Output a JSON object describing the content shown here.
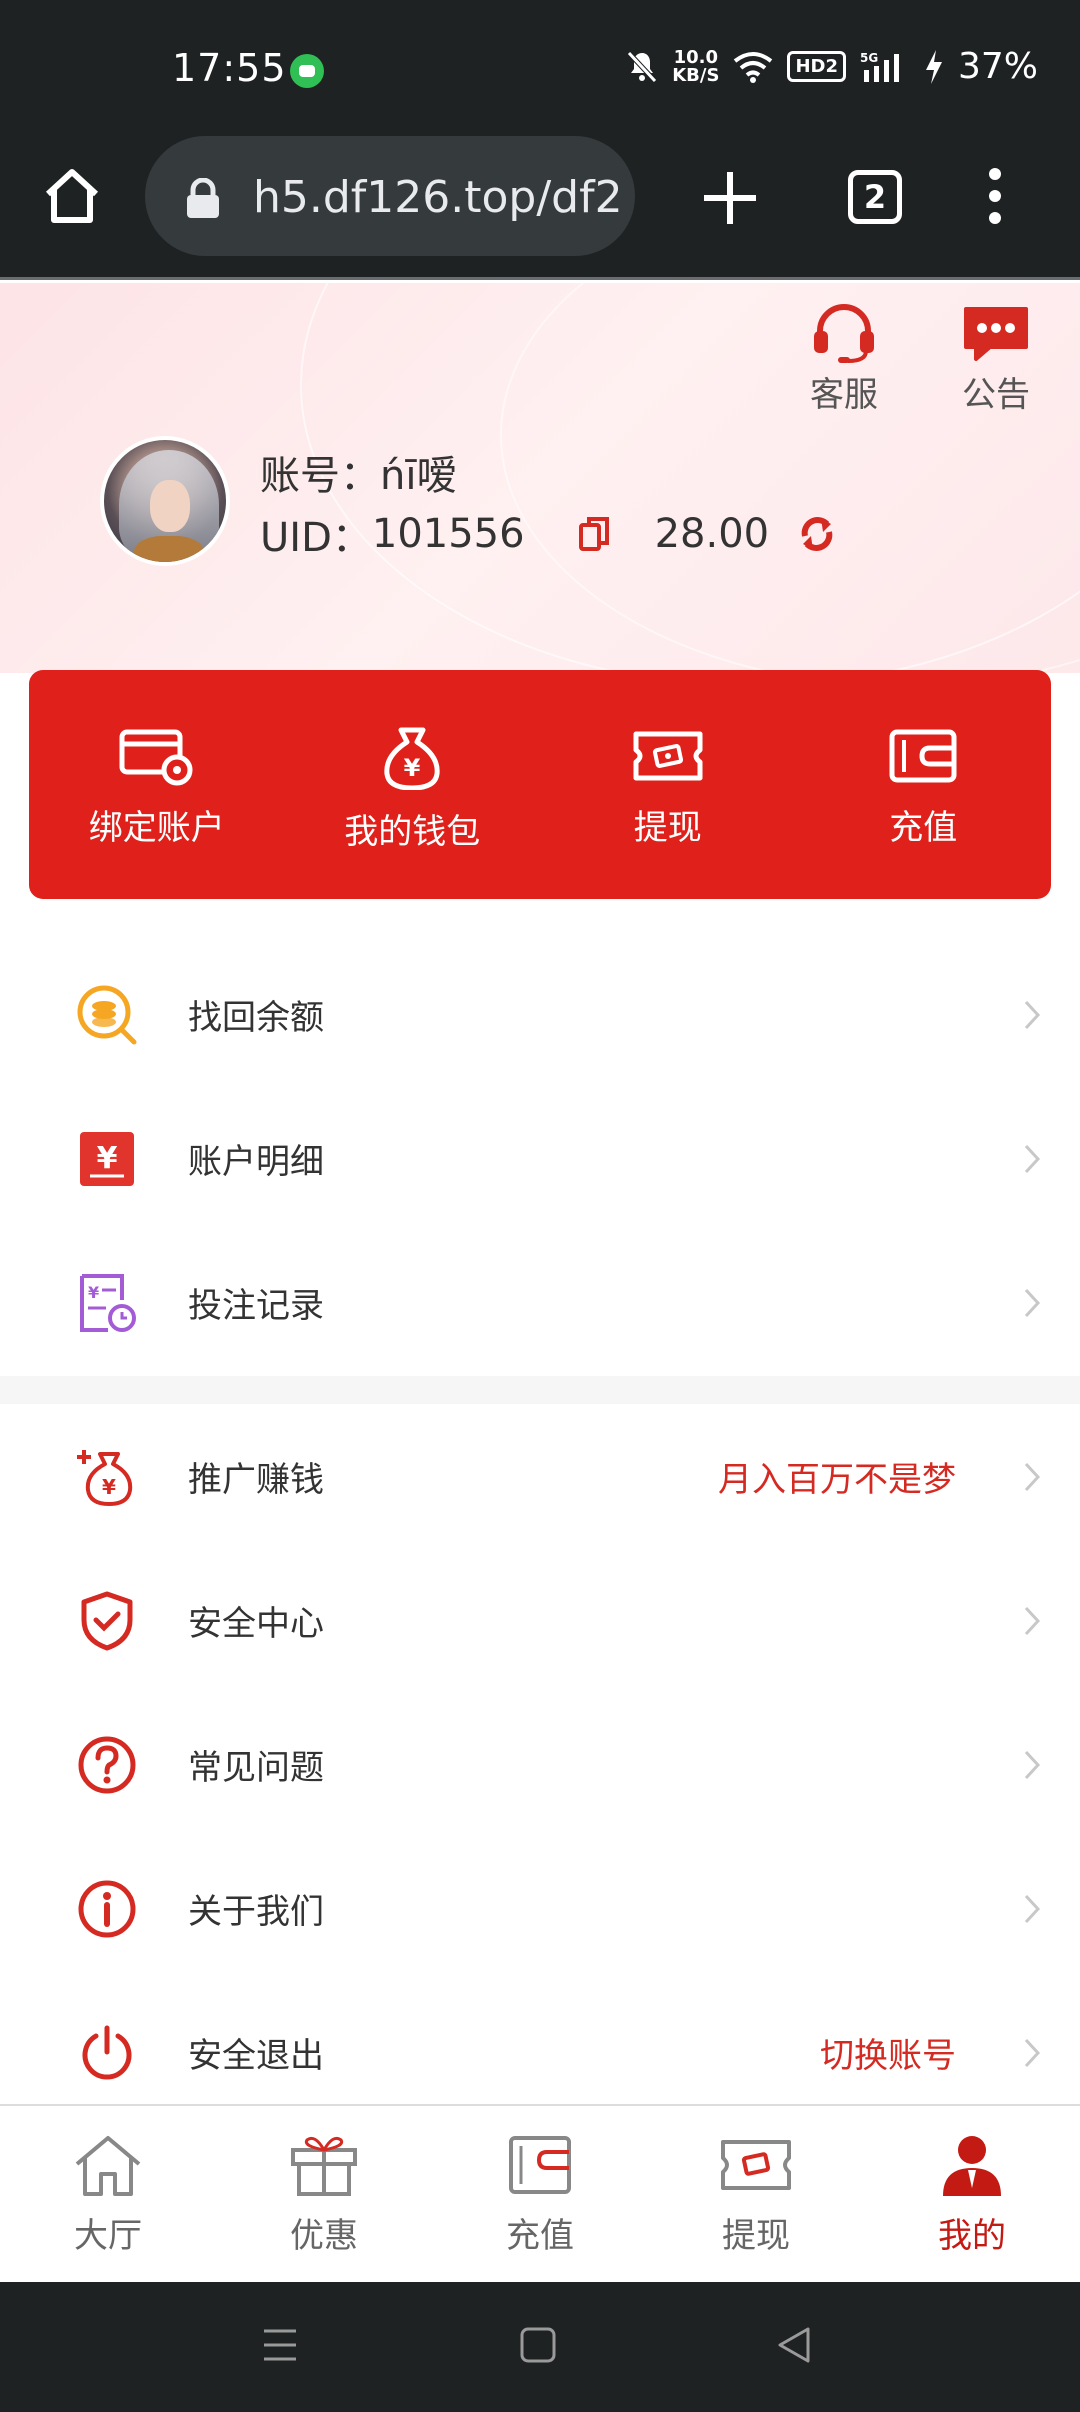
{
  "status_bar": {
    "time": "17:55",
    "net_speed_top": "10.0",
    "net_speed_bottom": "KB/S",
    "hd_badge": "HD2",
    "signal_label": "5G",
    "battery": "37%"
  },
  "browser": {
    "url": "h5.df126.top/df2",
    "tab_count": "2"
  },
  "header": {
    "service_label": "客服",
    "notice_label": "公告",
    "account_label": "账号：",
    "account_value": "ńī嗳",
    "uid_label": "UID：",
    "uid_value": "101556",
    "balance": "28.00"
  },
  "quick_actions": [
    {
      "label": "绑定账户",
      "icon": "card-settings-icon"
    },
    {
      "label": "我的钱包",
      "icon": "money-bag-icon"
    },
    {
      "label": "提现",
      "icon": "ticket-cash-icon"
    },
    {
      "label": "充值",
      "icon": "wallet-icon"
    }
  ],
  "menu_group1": [
    {
      "label": "找回余额",
      "icon": "coin-search-icon"
    },
    {
      "label": "账户明细",
      "icon": "yuan-document-icon"
    },
    {
      "label": "投注记录",
      "icon": "record-clock-icon"
    }
  ],
  "menu_group2": [
    {
      "label": "推广赚钱",
      "extra": "月入百万不是梦",
      "icon": "promo-money-bag-icon"
    },
    {
      "label": "安全中心",
      "extra": "",
      "icon": "shield-check-icon"
    },
    {
      "label": "常见问题",
      "extra": "",
      "icon": "question-circle-icon"
    },
    {
      "label": "关于我们",
      "extra": "",
      "icon": "info-circle-icon"
    },
    {
      "label": "安全退出",
      "extra": "切换账号",
      "icon": "power-icon"
    }
  ],
  "tab_bar": [
    {
      "label": "大厅",
      "icon": "home-icon"
    },
    {
      "label": "优惠",
      "icon": "gift-icon"
    },
    {
      "label": "充值",
      "icon": "wallet-icon"
    },
    {
      "label": "提现",
      "icon": "ticket-cash-icon"
    },
    {
      "label": "我的",
      "icon": "user-icon",
      "active": true
    }
  ],
  "colors": {
    "primary_red": "#e0201a",
    "accent_red": "#d42a22",
    "dark_bar": "#1f2223"
  }
}
